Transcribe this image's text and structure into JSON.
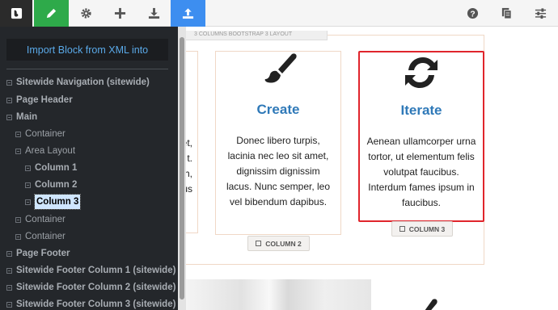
{
  "toolbar": {
    "buttons": [
      "logo-icon",
      "pencil-icon",
      "gear-icon",
      "plus-icon",
      "download-icon",
      "upload-icon",
      "question-icon",
      "document-icon",
      "sliders-icon"
    ],
    "colors": {
      "bar": "#f5f5f5",
      "logo": "#2b2b2b",
      "edit_active": "#2eaa4a",
      "upload_active": "#3d8ef0"
    }
  },
  "sidebar": {
    "import_label": "Import Block from XML into",
    "tree": [
      {
        "label": "Sitewide Navigation (sitewide)",
        "bold": true
      },
      {
        "label": "Page Header",
        "bold": true
      },
      {
        "label": "Main",
        "bold": true
      },
      {
        "label": "Container",
        "bold": false
      },
      {
        "label": "Area Layout",
        "bold": false
      },
      {
        "label": "Column 1",
        "bold": true
      },
      {
        "label": "Column 2",
        "bold": true
      },
      {
        "label": "Column 3",
        "bold": true,
        "selected": true
      },
      {
        "label": "Container",
        "bold": false
      },
      {
        "label": "Container",
        "bold": false
      },
      {
        "label": "Page Footer",
        "bold": true
      },
      {
        "label": "Sitewide Footer Column 1 (sitewide)",
        "bold": true
      },
      {
        "label": "Sitewide Footer Column 2 (sitewide)",
        "bold": true
      },
      {
        "label": "Sitewide Footer Column 3 (sitewide)",
        "bold": true
      }
    ]
  },
  "canvas": {
    "layout_label": "3 COLUMNS BOOTSTRAP 3 LAYOUT",
    "left_fragments": [
      "et,",
      "t.",
      "h,",
      "us"
    ],
    "columns": [
      {
        "icon": "paintbrush-icon",
        "title": "Create",
        "text": "Donec libero turpis, lacinia nec leo sit amet, dignissim dignissim lacus. Nunc semper, leo vel bibendum dapibus.",
        "tag": "COLUMN 2"
      },
      {
        "icon": "refresh-icon",
        "title": "Iterate",
        "text": "Aenean ullamcorper urna tortor, ut elementum felis volutpat faucibus. Interdum fames ipsum in faucibus.",
        "tag": "COLUMN 3"
      }
    ],
    "colors": {
      "title": "#2f79b8",
      "selection_border": "#e0252c",
      "frame": "#f0d8c6"
    }
  }
}
